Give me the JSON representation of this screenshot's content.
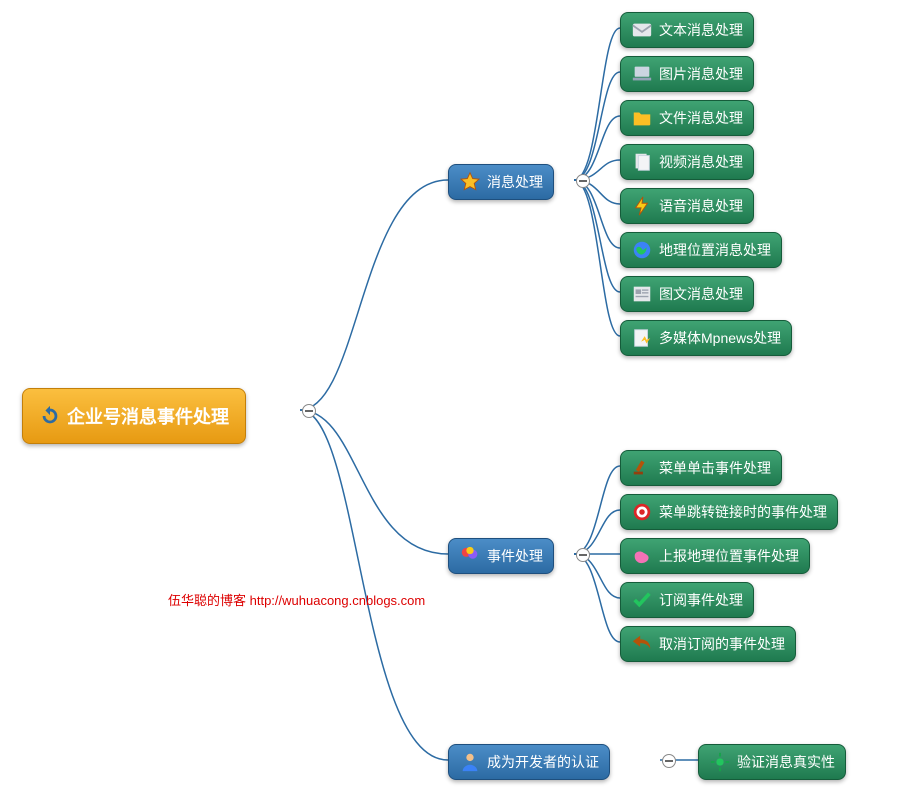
{
  "root": {
    "label": "企业号消息事件处理",
    "icon": "refresh-icon"
  },
  "branches": [
    {
      "label": "消息处理",
      "icon": "star-icon",
      "leaves": [
        {
          "label": "文本消息处理",
          "icon": "mail-icon"
        },
        {
          "label": "图片消息处理",
          "icon": "laptop-icon"
        },
        {
          "label": "文件消息处理",
          "icon": "folder-icon"
        },
        {
          "label": "视频消息处理",
          "icon": "document-icon"
        },
        {
          "label": "语音消息处理",
          "icon": "bolt-icon"
        },
        {
          "label": "地理位置消息处理",
          "icon": "globe-icon"
        },
        {
          "label": "图文消息处理",
          "icon": "news-icon"
        },
        {
          "label": "多媒体Mpnews处理",
          "icon": "mpnews-icon"
        }
      ]
    },
    {
      "label": "事件处理",
      "icon": "balloons-icon",
      "leaves": [
        {
          "label": "菜单单击事件处理",
          "icon": "gavel-icon"
        },
        {
          "label": "菜单跳转链接时的事件处理",
          "icon": "target-icon"
        },
        {
          "label": "上报地理位置事件处理",
          "icon": "mapblob-icon"
        },
        {
          "label": "订阅事件处理",
          "icon": "check-icon"
        },
        {
          "label": "取消订阅的事件处理",
          "icon": "undo-icon"
        }
      ]
    },
    {
      "label": "成为开发者的认证",
      "icon": "person-icon",
      "leaves": [
        {
          "label": "验证消息真实性",
          "icon": "gear-icon"
        }
      ]
    }
  ],
  "credit": {
    "text": "伍华聪的博客 ",
    "link_text": "http://wuhuacong.cnblogs.com"
  }
}
